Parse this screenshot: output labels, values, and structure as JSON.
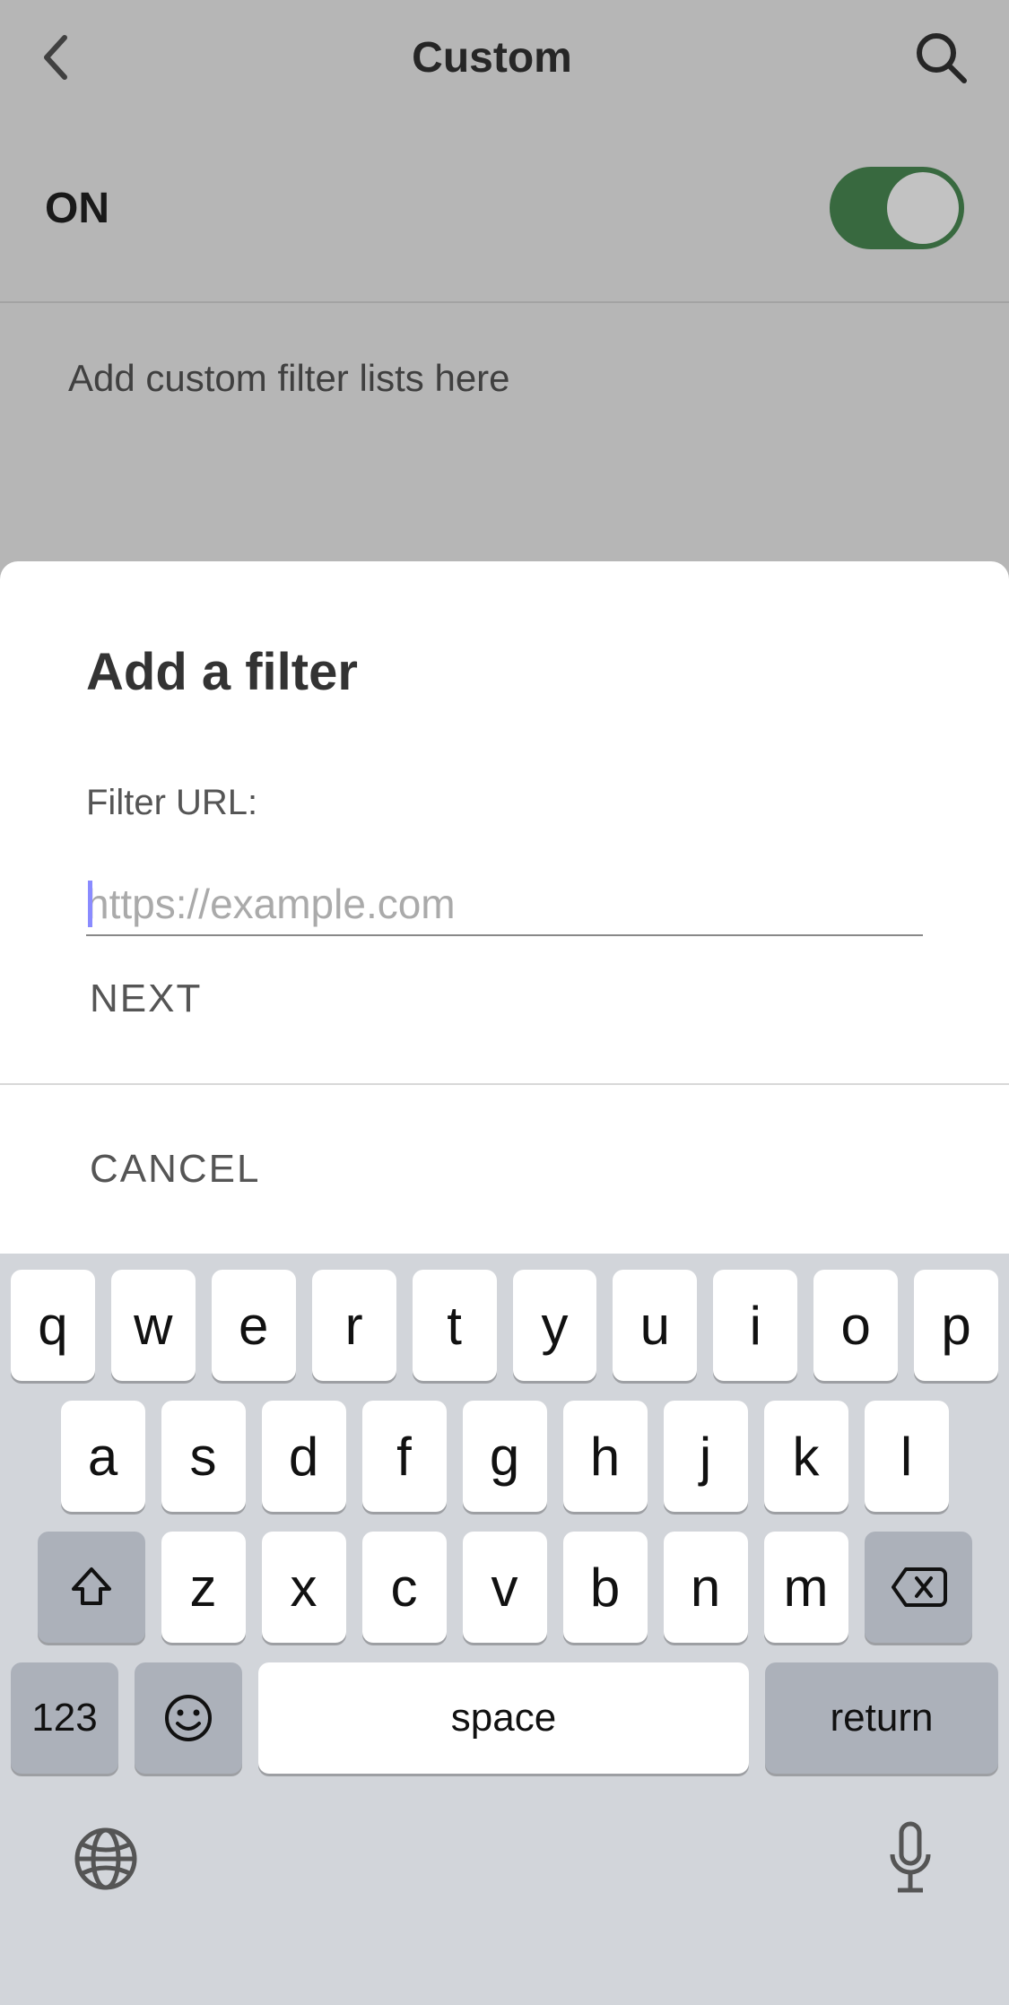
{
  "header": {
    "title": "Custom"
  },
  "toggle": {
    "label": "ON",
    "state": "on"
  },
  "hint": "Add custom filter lists here",
  "dialog": {
    "title": "Add a filter",
    "field_label": "Filter URL:",
    "input_value": "",
    "input_placeholder": "https://example.com",
    "next_label": "NEXT",
    "cancel_label": "CANCEL"
  },
  "keyboard": {
    "row1": [
      "q",
      "w",
      "e",
      "r",
      "t",
      "y",
      "u",
      "i",
      "o",
      "p"
    ],
    "row2": [
      "a",
      "s",
      "d",
      "f",
      "g",
      "h",
      "j",
      "k",
      "l"
    ],
    "row3": [
      "z",
      "x",
      "c",
      "v",
      "b",
      "n",
      "m"
    ],
    "numbers_label": "123",
    "space_label": "space",
    "return_label": "return",
    "shift_icon": "shift-icon",
    "backspace_icon": "backspace-icon",
    "emoji_icon": "emoji-icon",
    "globe_icon": "globe-icon",
    "mic_icon": "mic-icon"
  }
}
